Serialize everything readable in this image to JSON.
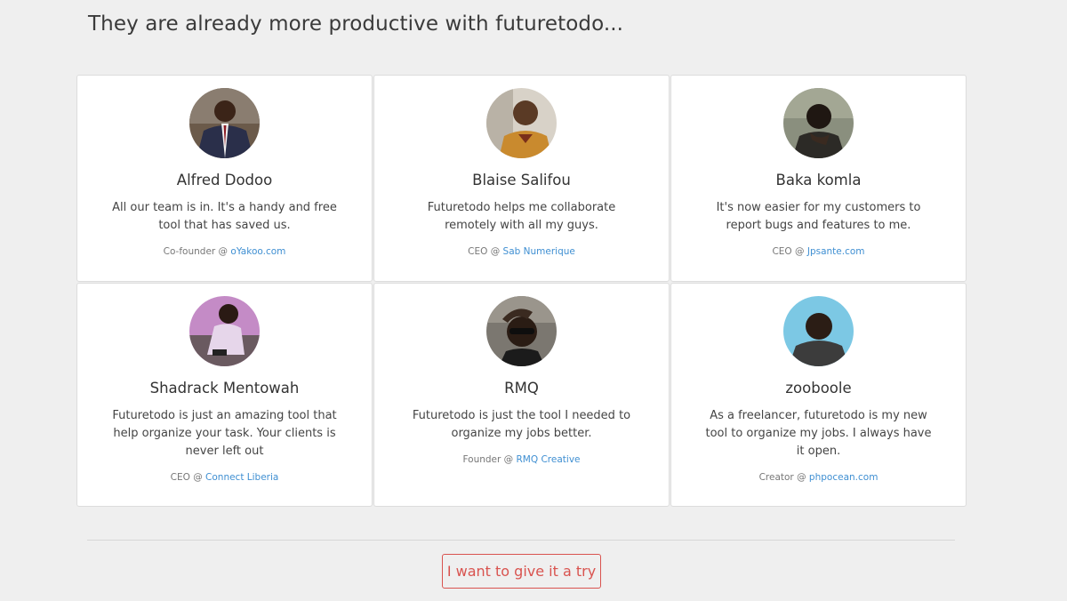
{
  "section": {
    "title": "They are already more productive with futuretodo..."
  },
  "testimonials": [
    {
      "name": "Alfred Dodoo",
      "quote": "All our team is in. It's a handy and free tool that has saved us.",
      "role_prefix": "Co-founder @ ",
      "company": "oYakoo.com",
      "avatar": "avatar-alfred-dodoo"
    },
    {
      "name": "Blaise Salifou",
      "quote": "Futuretodo helps me collaborate remotely with all my guys.",
      "role_prefix": "CEO @ ",
      "company": "Sab Numerique",
      "avatar": "avatar-blaise-salifou"
    },
    {
      "name": "Baka komla",
      "quote": "It's now easier for my customers to report bugs and features to me.",
      "role_prefix": "CEO @ ",
      "company": "Jpsante.com",
      "avatar": "avatar-baka-komla"
    },
    {
      "name": "Shadrack Mentowah",
      "quote": "Futuretodo is just an amazing tool that help organize your task. Your clients is never left out",
      "role_prefix": "CEO @ ",
      "company": "Connect Liberia",
      "avatar": "avatar-shadrack-mentowah"
    },
    {
      "name": "RMQ",
      "quote": "Futuretodo is just the tool I needed to organize my jobs better.",
      "role_prefix": "Founder @ ",
      "company": "RMQ Creative",
      "avatar": "avatar-rmq"
    },
    {
      "name": "zooboole",
      "quote": "As a freelancer, futuretodo is my new tool to organize my jobs. I always have it open.",
      "role_prefix": "Creator @ ",
      "company": "phpocean.com",
      "avatar": "avatar-zooboole"
    }
  ],
  "cta": {
    "label": "I want to give it a try"
  },
  "colors": {
    "background": "#efefef",
    "card": "#ffffff",
    "link": "#3f8fd2",
    "cta": "#d9534f"
  }
}
